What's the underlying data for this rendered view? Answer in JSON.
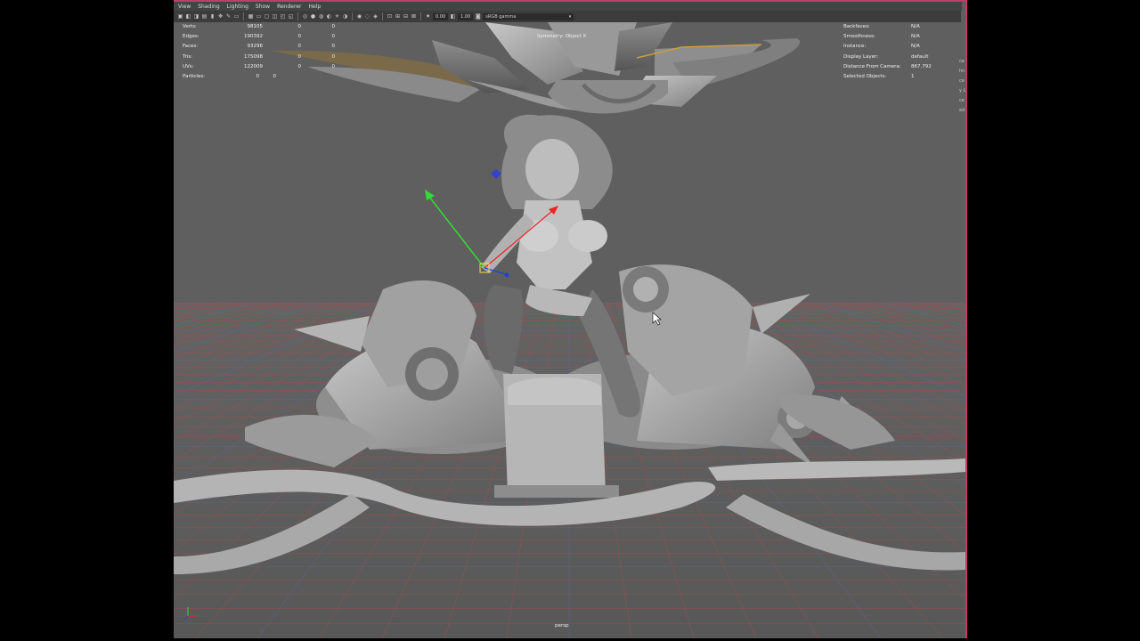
{
  "menu": [
    "View",
    "Shading",
    "Lighting",
    "Show",
    "Renderer",
    "Help"
  ],
  "toolbar": {
    "exposure": "0.00",
    "gamma": "1.00",
    "colorspace": "sRGB gamma"
  },
  "hud_left": [
    {
      "label": "Verts:",
      "v1": "98105",
      "v2": "0",
      "v3": "0"
    },
    {
      "label": "Edges:",
      "v1": "190392",
      "v2": "0",
      "v3": "0"
    },
    {
      "label": "Faces:",
      "v1": "93296",
      "v2": "0",
      "v3": "0"
    },
    {
      "label": "Tris:",
      "v1": "175098",
      "v2": "0",
      "v3": "0"
    },
    {
      "label": "UVs:",
      "v1": "122009",
      "v2": "0",
      "v3": "0"
    },
    {
      "label": "Particles:",
      "v1": "0",
      "v2": "0",
      "v3": ""
    }
  ],
  "hud_right": [
    {
      "label": "Backfaces:",
      "value": "N/A"
    },
    {
      "label": "Smoothness:",
      "value": "N/A"
    },
    {
      "label": "Instance:",
      "value": "N/A"
    },
    {
      "label": "Display Layer:",
      "value": "default"
    },
    {
      "label": "Distance From Camera:",
      "value": "867.792"
    },
    {
      "label": "Selected Objects:",
      "value": "1"
    }
  ],
  "symmetry_label": "Symmetry: Object X",
  "camera_label": "persp",
  "colors": {
    "viewport_bg": "#5f5f5f",
    "panel_accent": "#c23b6a",
    "grid_red": "#b24a4a",
    "grid_blue": "#5a6aa0",
    "model_gray": "#a8a8a8",
    "manip_green": "#33dd33",
    "manip_red": "#ee2222",
    "manip_blue": "#2244cc"
  },
  "right_strip_chars": [
    "ce",
    "hn",
    "ce",
    "y L",
    "ce",
    "ed"
  ]
}
